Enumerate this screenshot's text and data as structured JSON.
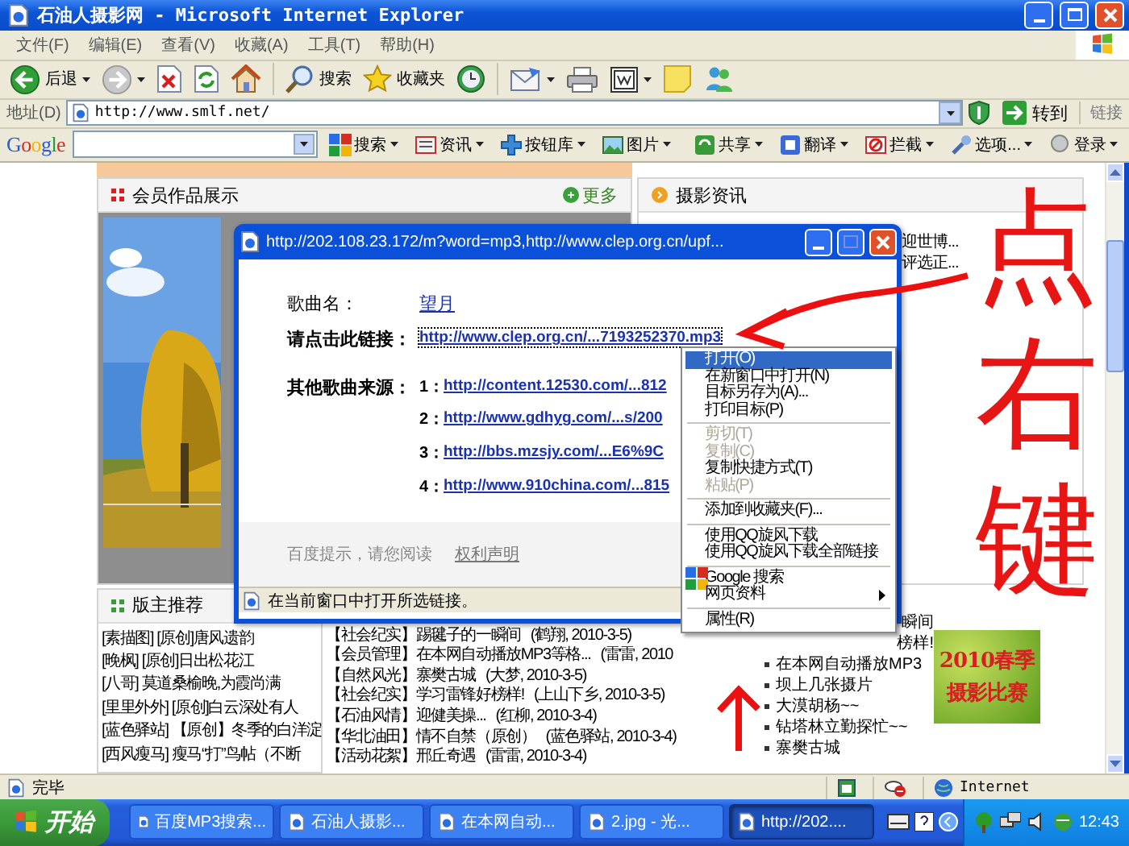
{
  "window": {
    "title": "石油人摄影网 - Microsoft Internet Explorer"
  },
  "menu_bar": [
    "文件(F)",
    "编辑(E)",
    "查看(V)",
    "收藏(A)",
    "工具(T)",
    "帮助(H)"
  ],
  "toolbar": {
    "back": "后退",
    "search": "搜索",
    "favorites": "收藏夹"
  },
  "address_bar": {
    "label": "地址(D)",
    "url": "http://www.smlf.net/",
    "go": "转到",
    "links": "链接"
  },
  "google_bar": {
    "logo": "Google",
    "search": "搜索",
    "left_buttons": [
      "资讯",
      "按钮库",
      "图片"
    ],
    "right_buttons": [
      "共享",
      "翻译",
      "拦截",
      "选项...",
      "登录"
    ]
  },
  "page": {
    "gallery": {
      "title": "会员作品展示",
      "more": "更多"
    },
    "news": {
      "title": "摄影资讯",
      "items": [
        "迎世博...",
        "评选正..."
      ]
    },
    "recommend": {
      "title": "版主推荐",
      "items": [
        "[素描图] [原创]唐风遗韵",
        "[晚枫] [原创]日出松花江",
        "[八哥] 莫道桑榆晚,为霞尚满",
        "[里里外外] [原创]白云深处有人",
        "[蓝色驿站] 【原创】冬季的白洋淀",
        "[西风瘦马] 瘦马“打”鸟帖（不断"
      ]
    },
    "articles": [
      {
        "title": "【社会纪实】踢毽子的一瞬间",
        "meta": "(鹤翔, 2010-3-5)"
      },
      {
        "title": "【会员管理】在本网自动播放MP3等格...",
        "meta": "(雷雷, 2010"
      },
      {
        "title": "【自然风光】寨樊古城",
        "meta": "(大梦, 2010-3-5)"
      },
      {
        "title": "【社会纪实】学习雷锋好榜样!",
        "meta": "(上山下乡, 2010-3-5)"
      },
      {
        "title": "【石油风情】迎健美操...",
        "meta": "(红柳, 2010-3-4)"
      },
      {
        "title": "【华北油田】情不自禁（原创）",
        "meta": "(蓝色驿站, 2010-3-4)"
      },
      {
        "title": "【活动花絮】邢丘奇遇",
        "meta": "(雷雷, 2010-3-4)"
      }
    ],
    "side_list": [
      {
        "kind": "fragment",
        "text": "瞬间"
      },
      {
        "kind": "fragment",
        "text": "榜样!"
      },
      {
        "kind": "bullet",
        "text": "在本网自动播放MP3"
      },
      {
        "kind": "bullet",
        "text": "坝上几张摄片"
      },
      {
        "kind": "bullet",
        "text": "大漠胡杨~~"
      },
      {
        "kind": "bullet",
        "text": "钻塔林立勤探忙~~"
      },
      {
        "kind": "bullet",
        "text": "寨樊古城"
      }
    ],
    "banner": {
      "lines": [
        "2010春季",
        "摄影比赛"
      ]
    }
  },
  "popup": {
    "title": "http://202.108.23.172/m?word=mp3,http://www.clep.org.cn/upf...",
    "song_label": "歌曲名：",
    "song": "望月",
    "link_label": "请点击此链接：",
    "link": "http://www.clep.org.cn/...7193252370.mp3",
    "other_label": "其他歌曲来源：",
    "sources": [
      {
        "index": "1：",
        "url": "http://content.12530.com/...812"
      },
      {
        "index": "2：",
        "url": "http://www.gdhyg.com/...s/200"
      },
      {
        "index": "3：",
        "url": "http://bbs.mzsjy.com/...E6%9C"
      },
      {
        "index": "4：",
        "url": "http://www.910china.com/...815"
      }
    ],
    "footer_note": "百度提示，请您阅读",
    "footer_link": "权利声明",
    "status": "在当前窗口中打开所选链接。"
  },
  "context_menu": {
    "groups": [
      [
        {
          "kind": "plain",
          "label": "打开(O)",
          "selected": true,
          "disabled": false
        },
        {
          "kind": "plain",
          "label": "在新窗口中打开(N)",
          "selected": false,
          "disabled": false
        },
        {
          "kind": "plain",
          "label": "目标另存为(A)...",
          "selected": false,
          "disabled": false
        },
        {
          "kind": "plain",
          "label": "打印目标(P)",
          "selected": false,
          "disabled": false
        }
      ],
      [
        {
          "kind": "plain",
          "label": "剪切(T)",
          "selected": false,
          "disabled": true
        },
        {
          "kind": "plain",
          "label": "复制(C)",
          "selected": false,
          "disabled": true
        },
        {
          "kind": "plain",
          "label": "复制快捷方式(T)",
          "selected": false,
          "disabled": false
        },
        {
          "kind": "plain",
          "label": "粘贴(P)",
          "selected": false,
          "disabled": true
        }
      ],
      [
        {
          "kind": "plain",
          "label": "添加到收藏夹(F)...",
          "selected": false,
          "disabled": false
        }
      ],
      [
        {
          "kind": "plain",
          "label": "使用QQ旋风下载",
          "selected": false,
          "disabled": false
        },
        {
          "kind": "plain",
          "label": "使用QQ旋风下载全部链接",
          "selected": false,
          "disabled": false
        }
      ],
      [
        {
          "kind": "google",
          "label": "Google 搜索",
          "selected": false,
          "disabled": false
        },
        {
          "kind": "submenu",
          "label": "网页资料",
          "selected": false,
          "disabled": false
        }
      ],
      [
        {
          "kind": "plain",
          "label": "属性(R)",
          "selected": false,
          "disabled": false
        }
      ]
    ]
  },
  "annotation": {
    "text": "点右键"
  },
  "status_bar": {
    "text": "完毕",
    "zone": "Internet"
  },
  "taskbar": {
    "start": "开始",
    "tasks": [
      {
        "label": "百度MP3搜索...",
        "selected": false
      },
      {
        "label": "石油人摄影...",
        "selected": false
      },
      {
        "label": "在本网自动...",
        "selected": false
      },
      {
        "label": "2.jpg - 光...",
        "selected": false
      },
      {
        "label": "http://202....",
        "selected": true
      }
    ],
    "clock": "12:43"
  }
}
